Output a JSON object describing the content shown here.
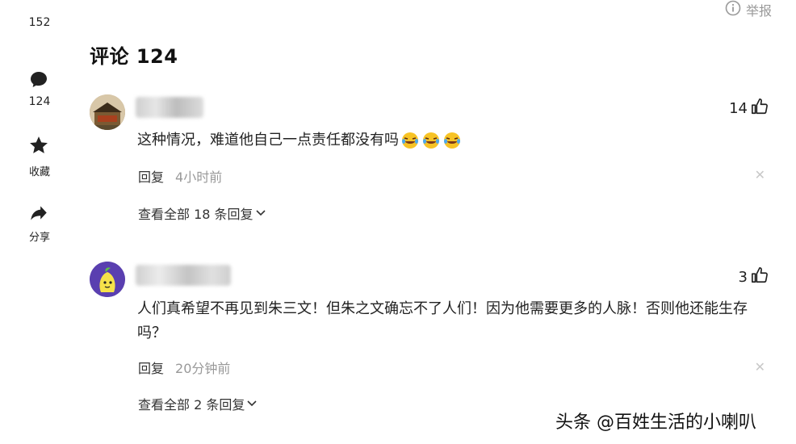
{
  "sidebar": {
    "like_count": "152",
    "comment_count": "124",
    "favorite_label": "收藏",
    "share_label": "分享"
  },
  "header": {
    "report_label": "举报",
    "title": "评论 124"
  },
  "comments": [
    {
      "like_count": "14",
      "content": "这种情况，难道他自己一点责任都没有吗",
      "reply_label": "回复",
      "time": "4小时前",
      "expand_label": "查看全部 18 条回复"
    },
    {
      "like_count": "3",
      "content": "人们真希望不再见到朱三文！但朱之文确忘不了人们！因为他需要更多的人脉！否则他还能生存吗？",
      "reply_label": "回复",
      "time": "20分钟前",
      "expand_label": "查看全部 2 条回复"
    }
  ],
  "watermark": "头条 @百姓生活的小喇叭",
  "colors": {
    "text": "#222222",
    "muted": "#999999",
    "icon": "#222222",
    "background": "#ffffff"
  },
  "icons": {
    "comment": "comment-bubble-icon",
    "favorite": "star-icon",
    "share": "share-arrow-icon",
    "report": "info-circle-icon",
    "like": "thumb-up-icon",
    "expand": "chevron-down-icon",
    "close": "close-icon",
    "emoji": "laughing-crying-emoji-icon"
  }
}
